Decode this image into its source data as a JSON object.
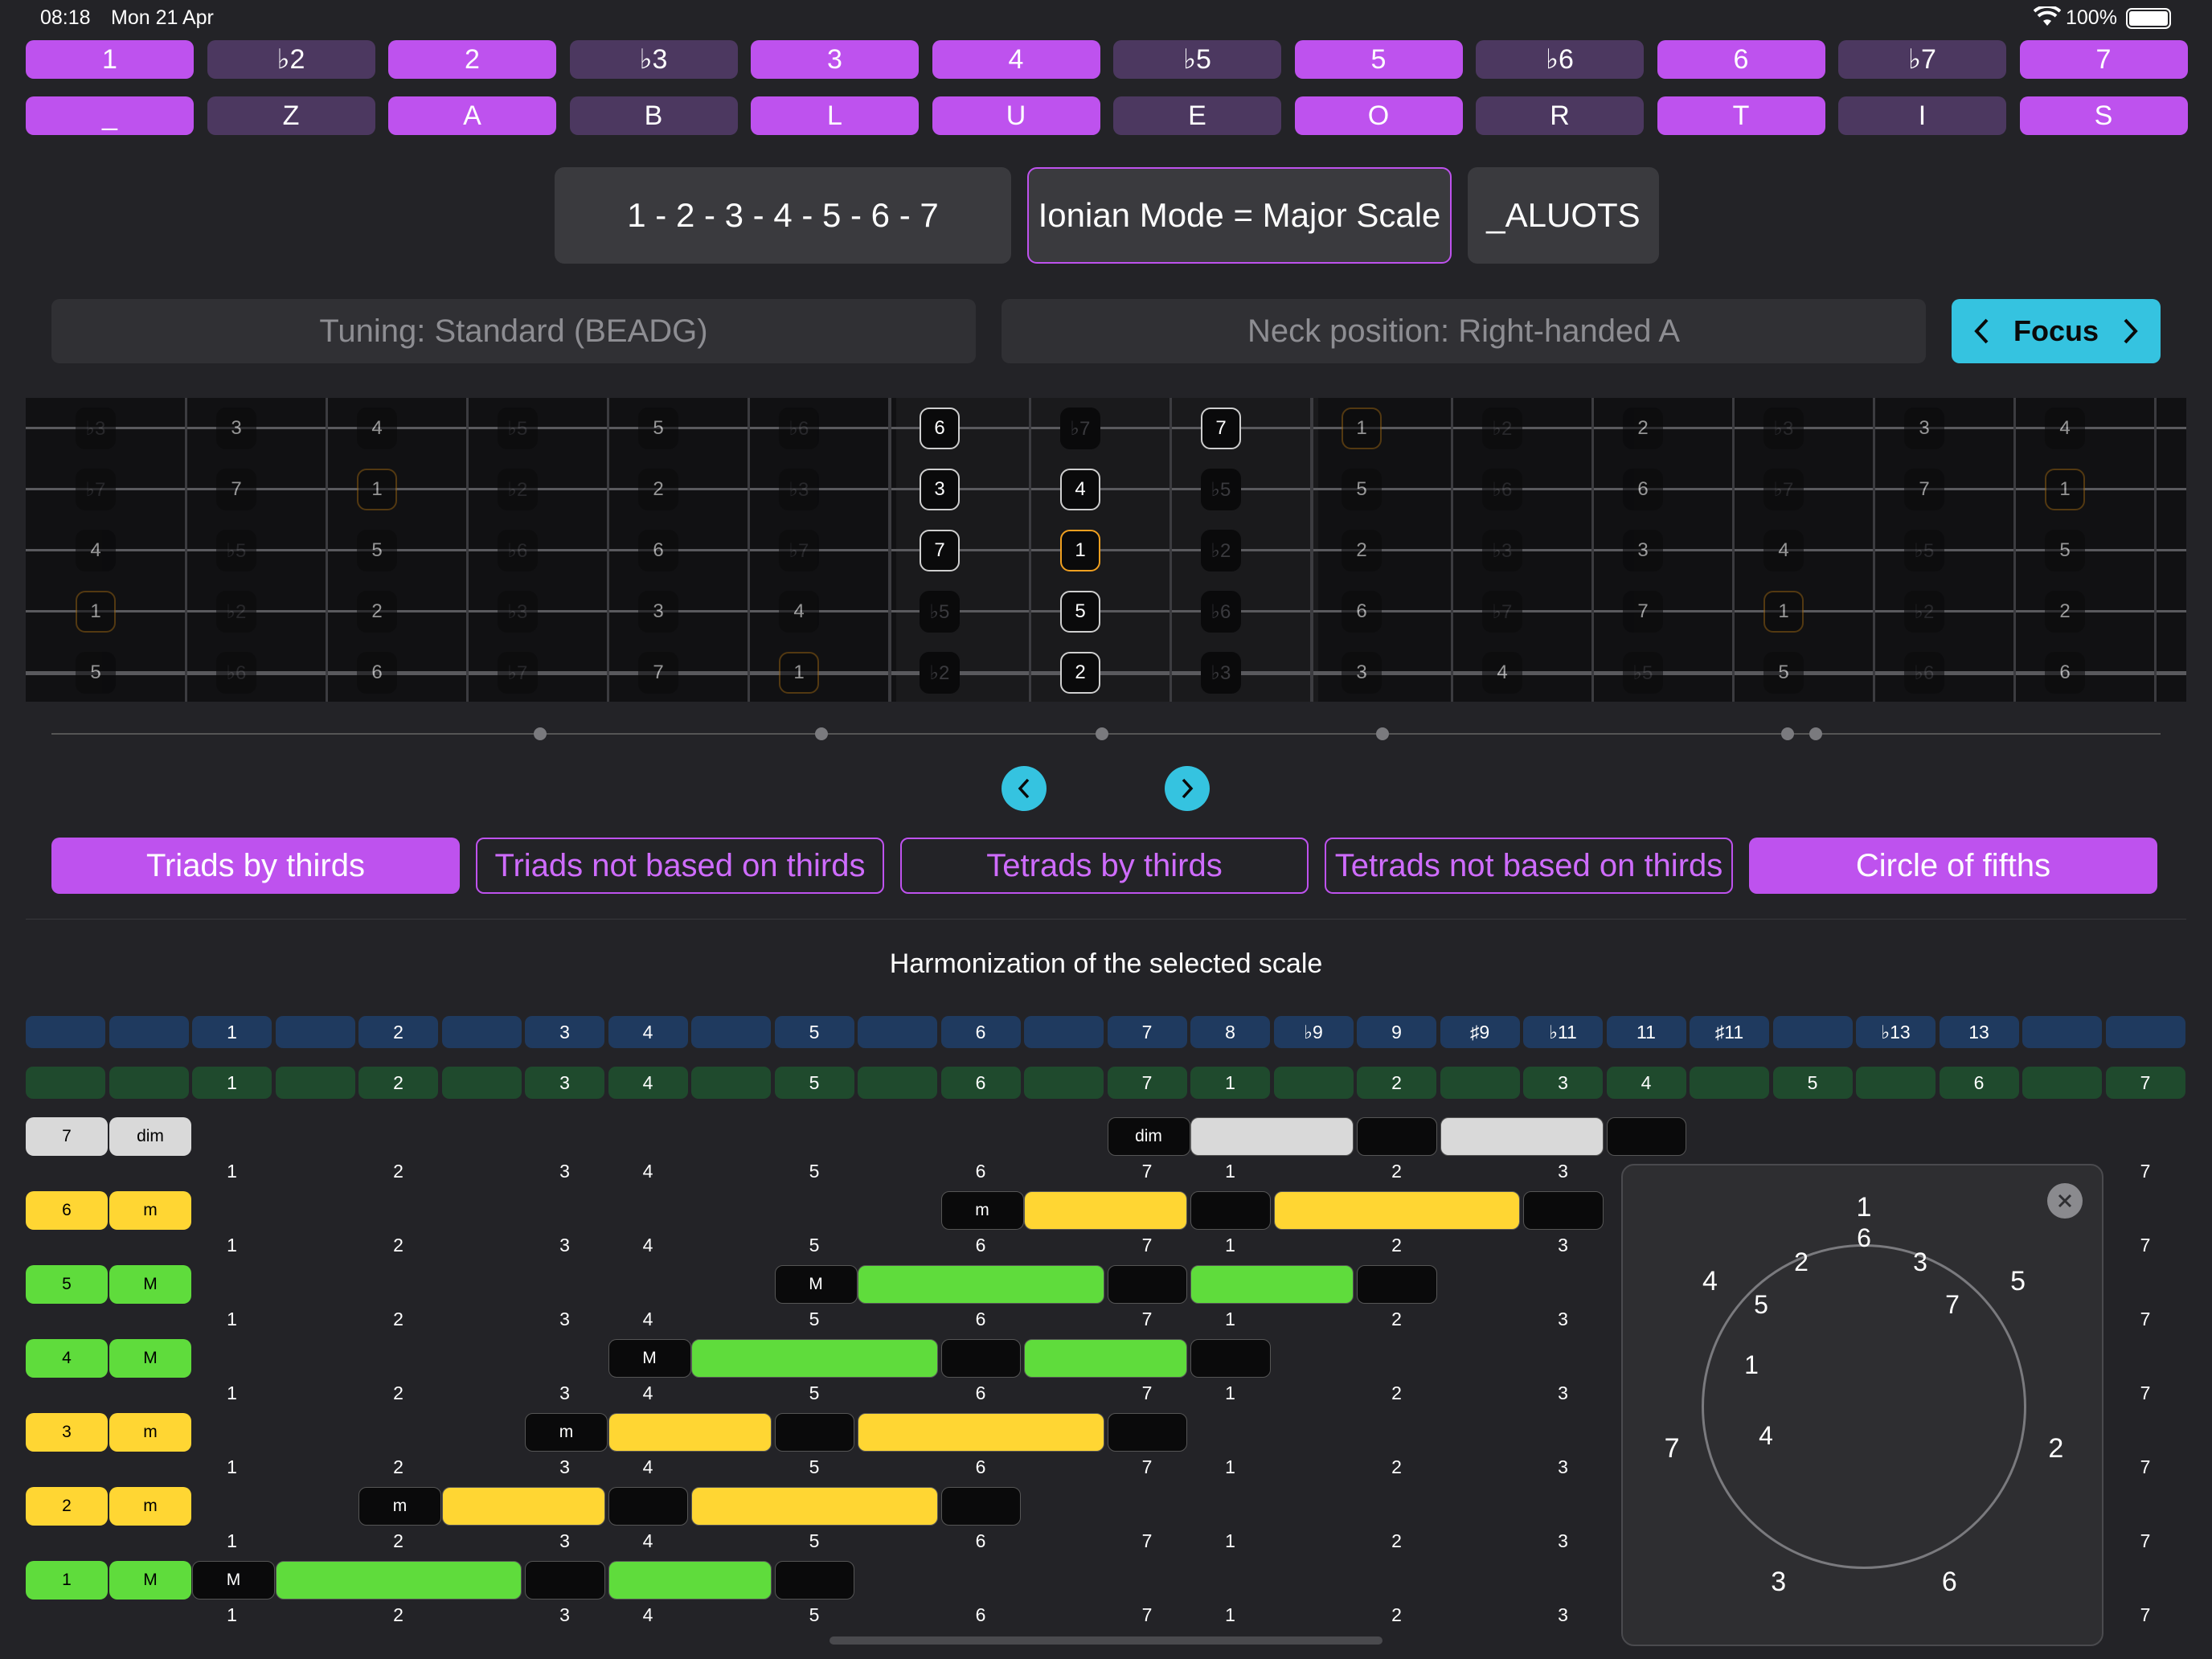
{
  "status": {
    "time": "08:18",
    "date": "Mon 21 Apr",
    "battery": "100%",
    "wifi_icon": "wifi-icon",
    "battery_icon": "battery-icon"
  },
  "intervals_row": [
    {
      "label": "1",
      "on": true
    },
    {
      "label": "♭2",
      "on": false
    },
    {
      "label": "2",
      "on": true
    },
    {
      "label": "♭3",
      "on": false
    },
    {
      "label": "3",
      "on": true
    },
    {
      "label": "4",
      "on": true
    },
    {
      "label": "♭5",
      "on": false
    },
    {
      "label": "5",
      "on": true
    },
    {
      "label": "♭6",
      "on": false
    },
    {
      "label": "6",
      "on": true
    },
    {
      "label": "♭7",
      "on": false
    },
    {
      "label": "7",
      "on": true
    }
  ],
  "letters_row": [
    {
      "label": "_",
      "on": true
    },
    {
      "label": "Z",
      "on": false
    },
    {
      "label": "A",
      "on": true
    },
    {
      "label": "B",
      "on": false
    },
    {
      "label": "L",
      "on": true
    },
    {
      "label": "U",
      "on": true
    },
    {
      "label": "E",
      "on": false
    },
    {
      "label": "O",
      "on": true
    },
    {
      "label": "R",
      "on": false
    },
    {
      "label": "T",
      "on": true
    },
    {
      "label": "I",
      "on": false
    },
    {
      "label": "S",
      "on": true
    }
  ],
  "scale": {
    "formula": "1 - 2 - 3 - 4 - 5 - 6 - 7",
    "name": "Ionian Mode = Major Scale",
    "code": "_ALUOTS"
  },
  "tuning": "Tuning: Standard (BEADG)",
  "neck_position": "Neck position: Right-handed A",
  "focus_label": "Focus",
  "fretboard": [
    [
      "♭3",
      "3",
      "4",
      "♭5",
      "5",
      "♭6",
      "6",
      "♭7",
      "7",
      "1",
      "♭2",
      "2",
      "♭3",
      "3",
      "4"
    ],
    [
      "♭7",
      "7",
      "1",
      "♭2",
      "2",
      "♭3",
      "3",
      "4",
      "♭5",
      "5",
      "♭6",
      "6",
      "♭7",
      "7",
      "1"
    ],
    [
      "4",
      "♭5",
      "5",
      "♭6",
      "6",
      "♭7",
      "7",
      "1",
      "♭2",
      "2",
      "♭3",
      "3",
      "4",
      "♭5",
      "5"
    ],
    [
      "1",
      "♭2",
      "2",
      "♭3",
      "3",
      "4",
      "♭5",
      "5",
      "♭6",
      "6",
      "♭7",
      "7",
      "1",
      "♭2",
      "2"
    ],
    [
      "5",
      "♭6",
      "6",
      "♭7",
      "7",
      "1",
      "♭2",
      "2",
      "♭3",
      "3",
      "4",
      "♭5",
      "5",
      "♭6",
      "6"
    ]
  ],
  "tabs": [
    {
      "label": "Triads by thirds",
      "on": true
    },
    {
      "label": "Triads not based on thirds",
      "on": false
    },
    {
      "label": "Tetrads by thirds",
      "on": false
    },
    {
      "label": "Tetrads not based on thirds",
      "on": false
    },
    {
      "label": "Circle of fifths",
      "on": true
    }
  ],
  "harmonization_title": "Harmonization of the selected scale",
  "header_blue": [
    "",
    "",
    "1",
    "",
    "2",
    "",
    "3",
    "4",
    "",
    "5",
    "",
    "6",
    "",
    "7",
    "8",
    "♭9",
    "9",
    "♯9",
    "♭11",
    "11",
    "♯11",
    "",
    "♭13",
    "13",
    "",
    ""
  ],
  "header_green": [
    "",
    "",
    "1",
    "",
    "2",
    "",
    "3",
    "4",
    "",
    "5",
    "",
    "6",
    "",
    "7",
    "1",
    "",
    "2",
    "",
    "3",
    "4",
    "",
    "5",
    "",
    "6",
    "",
    "7"
  ],
  "chords": [
    {
      "degree": "7",
      "quality": "dim",
      "color": "#d9d9d9",
      "label": "dim"
    },
    {
      "degree": "6",
      "quality": "m",
      "color": "#ffd633",
      "label": "m"
    },
    {
      "degree": "5",
      "quality": "M",
      "color": "#5fdc3c",
      "label": "M"
    },
    {
      "degree": "4",
      "quality": "M",
      "color": "#5fdc3c",
      "label": "M"
    },
    {
      "degree": "3",
      "quality": "m",
      "color": "#ffd633",
      "label": "m"
    },
    {
      "degree": "2",
      "quality": "m",
      "color": "#ffd633",
      "label": "m"
    },
    {
      "degree": "1",
      "quality": "M",
      "color": "#5fdc3c",
      "label": "M"
    }
  ],
  "degree_row": [
    "1",
    "2",
    "3",
    "4",
    "5",
    "6",
    "7",
    "1",
    "2",
    "3",
    "7"
  ],
  "circle": {
    "outer": [
      "1",
      "5",
      "2",
      "6",
      "3",
      "7",
      "4"
    ],
    "inner": [
      "6",
      "3",
      "7",
      "2",
      "5",
      "1",
      "4"
    ],
    "close_icon": "close-icon"
  },
  "colors": {
    "accent": "#be52ee",
    "accent_dim": "#4c3860",
    "focus": "#35c3e0",
    "header_blue": "#1f3a5f",
    "header_green": "#1f4a2d"
  }
}
